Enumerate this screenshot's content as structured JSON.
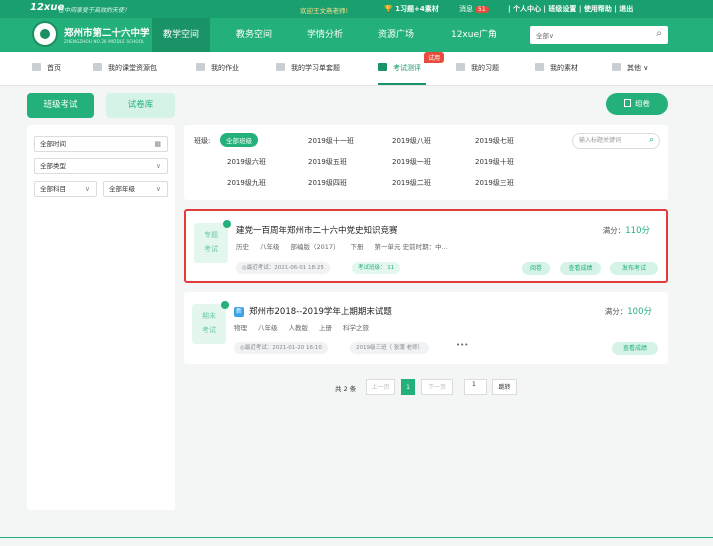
{
  "topbar": {
    "logo": "12xue",
    "slogan": "在中间享受于高效的天使！",
    "welcome": "欢迎王文燕老师!",
    "announcement": "1习题+4素材",
    "messages_label": "消息",
    "messages_count": "51",
    "links": "| 个人中心 | 班级设置 | 使用帮助 | 退出"
  },
  "nav": {
    "school_name": "郑州市第二十六中学",
    "school_sub": "ZHENGZHOU NO.26 MIDDLE SCHOOL",
    "items": [
      "教学空间",
      "教务空间",
      "学情分析",
      "资源广场",
      "12xue广角"
    ],
    "search_select": "全部∨"
  },
  "subnav": {
    "items": [
      "首页",
      "我的课堂资源包",
      "我的作业",
      "我的学习单套题",
      "考试测评",
      "我的习题",
      "我的素材",
      "其他 ∨"
    ],
    "badge": "试用"
  },
  "tabs": {
    "exam": "班级考试",
    "library": "试卷库"
  },
  "zujuan_label": "组卷",
  "filters": {
    "time": "全部时间",
    "type": "全部类型",
    "subject": "全部科目",
    "grade": "全部年级"
  },
  "classes": {
    "label": "班级:",
    "all": "全部班级",
    "row1": [
      "2019级十一班",
      "2019级八班",
      "2019级七班"
    ],
    "row2": [
      "2019级六班",
      "2019级五班",
      "2019级一班",
      "2019级十班"
    ],
    "row3": [
      "2019级九班",
      "2019级四班",
      "2019级二班",
      "2019级三班"
    ],
    "search_placeholder": "输入标题关键词"
  },
  "exams": [
    {
      "stamp1": "专题",
      "stamp2": "考试",
      "title": "建党一百周年郑州市二十六中党史知识竞赛",
      "meta": [
        "历史",
        "八年级",
        "部编版（2017）",
        "下册",
        "第一单元 史前时期：中..."
      ],
      "recent": "◎最近考试：2021-06-01 18:25",
      "classes_label": "考试班级： 11",
      "score_label": "满分：",
      "score": "110分",
      "buttons": [
        "阅卷",
        "查看成绩",
        "发布考试"
      ]
    },
    {
      "stamp1": "期末",
      "stamp2": "考试",
      "new_icon": "新",
      "title": "郑州市2018--2019学年上期期末试题",
      "meta": [
        "物理",
        "八年级",
        "人教版",
        "上册",
        "科学之旅"
      ],
      "recent": "◎最近考试：2021-01-20 16:10",
      "classes_label": "2019级三班（ 张蒲 老师）",
      "more": "•••",
      "score_label": "满分：",
      "score": "100分",
      "buttons": [
        "查看成绩"
      ]
    }
  ],
  "pager": {
    "total": "共 2 条",
    "prev": "上一页",
    "current": "1",
    "next": "下一页",
    "goto_value": "1",
    "jump": "跳转"
  }
}
